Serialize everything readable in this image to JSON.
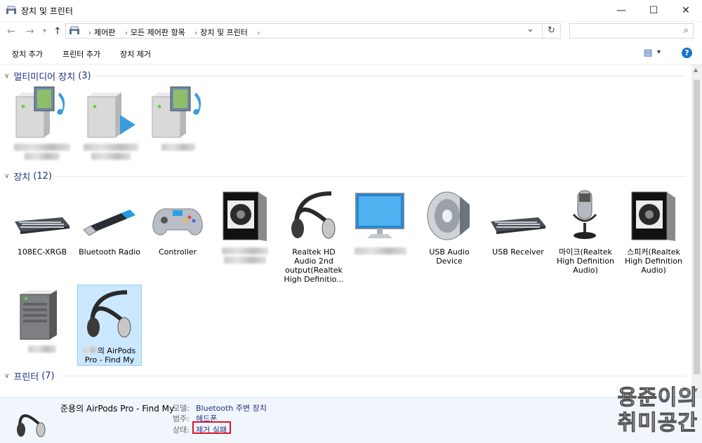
{
  "window": {
    "title": "장치 및 프린터",
    "minimize": "—",
    "maximize": "☐",
    "close": "✕"
  },
  "nav": {
    "back": "←",
    "forward": "→",
    "recent": "▾",
    "up": "↑"
  },
  "address": {
    "crumbs": [
      "제어판",
      "모든 제어판 항목",
      "장치 및 프린터"
    ],
    "dropdown": "⌄",
    "refresh": "↻"
  },
  "search": {
    "placeholder": "",
    "icon": "⌕"
  },
  "toolbar": {
    "add_device": "장치 추가",
    "add_printer": "프린터 추가",
    "remove_device": "장치 제거",
    "view_icon": "▤",
    "view_arrow": "▾",
    "help_icon": "?"
  },
  "groups": {
    "multimedia": {
      "label": "멀티미디어 장치",
      "count": "(3)",
      "chevron": "∨"
    },
    "devices": {
      "label": "장치",
      "count": "(12)",
      "chevron": "∨"
    },
    "printers": {
      "label": "프린터",
      "count": "(7)",
      "chevron": "∨"
    }
  },
  "devices": {
    "d1": "108EC-XRGB",
    "d2": "Bluetooth Radio",
    "d3": "Controller",
    "d5": "Realtek HD Audio 2nd output(Realtek High Definitio...",
    "d7": "USB Audio Device",
    "d8": "USB Receiver",
    "d9": "마이크(Realtek High Definition Audio)",
    "d10": "스피커(Realtek High Definition Audio)",
    "d12": "의 AirPods Pro - Find My"
  },
  "details": {
    "name": "준용의 AirPods Pro - Find My",
    "model_key": "모델:",
    "model_val": "Bluetooth 주변 장치",
    "category_key": "범주:",
    "category_val": "헤드폰",
    "status_key": "상태:",
    "status_val": "제거 실패"
  },
  "watermark": {
    "line1": "용준이의",
    "line2": "취미공간"
  },
  "colors": {
    "group_header": "#1e3287",
    "status_highlight": "#e0142a",
    "selection": "#cce8ff"
  }
}
